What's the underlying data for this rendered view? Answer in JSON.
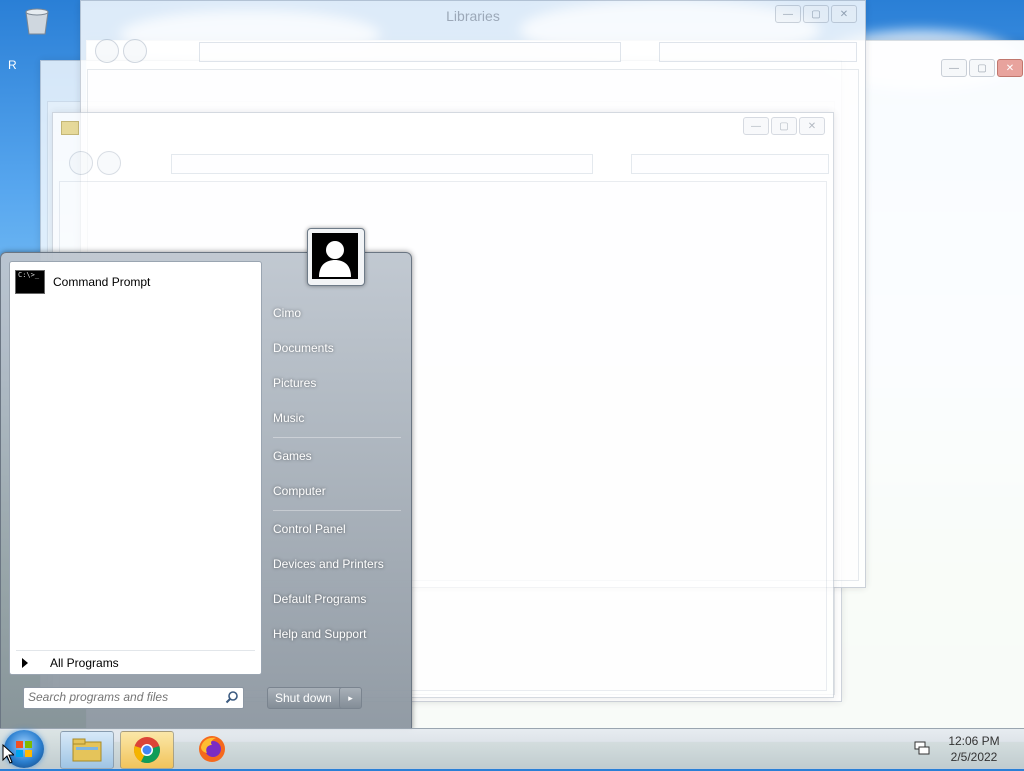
{
  "desktop": {
    "recycle_bin_label": "R"
  },
  "windows": {
    "libraries_title": "Libraries",
    "inner_title": ""
  },
  "start_menu": {
    "pinned_programs": [
      {
        "label": "Command Prompt",
        "icon": "command-prompt-icon"
      }
    ],
    "cmd_icon_text": "C:\\>_",
    "all_programs_label": "All Programs",
    "search_placeholder": "Search programs and files",
    "right_links": [
      {
        "label": "Cimo"
      },
      {
        "label": "Documents"
      },
      {
        "label": "Pictures"
      },
      {
        "label": "Music"
      },
      {
        "label": "Games"
      },
      {
        "label": "Computer"
      },
      {
        "label": "Control Panel"
      },
      {
        "label": "Devices and Printers"
      },
      {
        "label": "Default Programs"
      },
      {
        "label": "Help and Support"
      }
    ],
    "shutdown_label": "Shut down",
    "user_picture": "user-avatar-icon"
  },
  "taskbar": {
    "start_button": "windows-orb-icon",
    "pinned": [
      {
        "name": "explorer-icon"
      },
      {
        "name": "chrome-icon"
      },
      {
        "name": "firefox-icon"
      }
    ],
    "tray": {
      "time": "12:06 PM",
      "date": "2/5/2022",
      "network_icon": "network-icon"
    }
  },
  "colors": {
    "start_menu_pane": "#ffffff",
    "taskbar": "#dde3e9"
  }
}
